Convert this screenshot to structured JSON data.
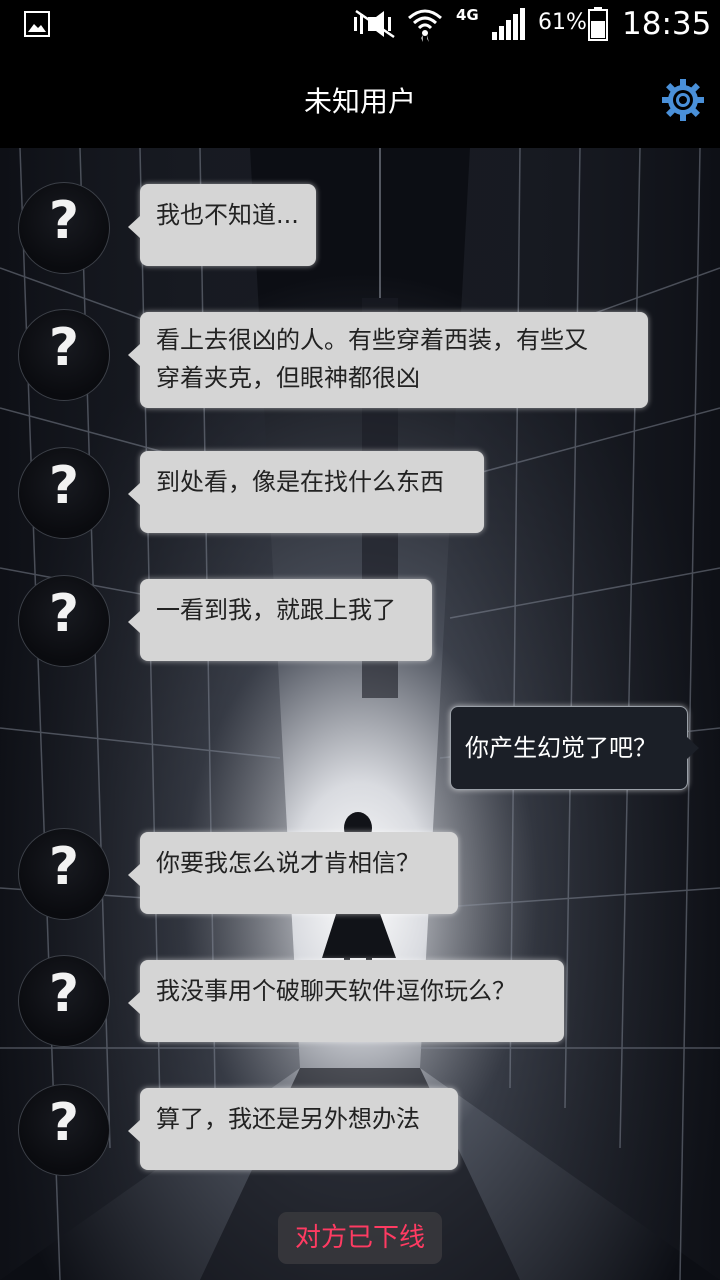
{
  "status_bar": {
    "network_type": "4G",
    "battery_percent": "61%",
    "battery_level": 0.61,
    "clock": "18:35",
    "icons": [
      "gallery-icon",
      "mute-icon",
      "wifi-icon",
      "signal-icon",
      "battery-icon"
    ]
  },
  "header": {
    "title": "未知用户",
    "settings_icon": "gear-icon",
    "accent_color": "#4a90d9"
  },
  "avatar_mark": "?",
  "messages": [
    {
      "side": "in",
      "text": "我也不知道..."
    },
    {
      "side": "in",
      "lines": [
        "看上去很凶的人。有些穿着西装，有些又",
        "穿着夹克，但眼神都很凶"
      ]
    },
    {
      "side": "in",
      "text": "到处看，像是在找什么东西"
    },
    {
      "side": "in",
      "text": "一看到我，就跟上我了"
    },
    {
      "side": "out",
      "text": "你产生幻觉了吧？"
    },
    {
      "side": "in",
      "text": "你要我怎么说才肯相信？"
    },
    {
      "side": "in",
      "text": "我没事用个破聊天软件逗你玩么？"
    },
    {
      "side": "in",
      "text": "算了，我还是另外想办法"
    }
  ],
  "offline_notice": {
    "text": "对方已下线",
    "color": "#ff3b62"
  }
}
